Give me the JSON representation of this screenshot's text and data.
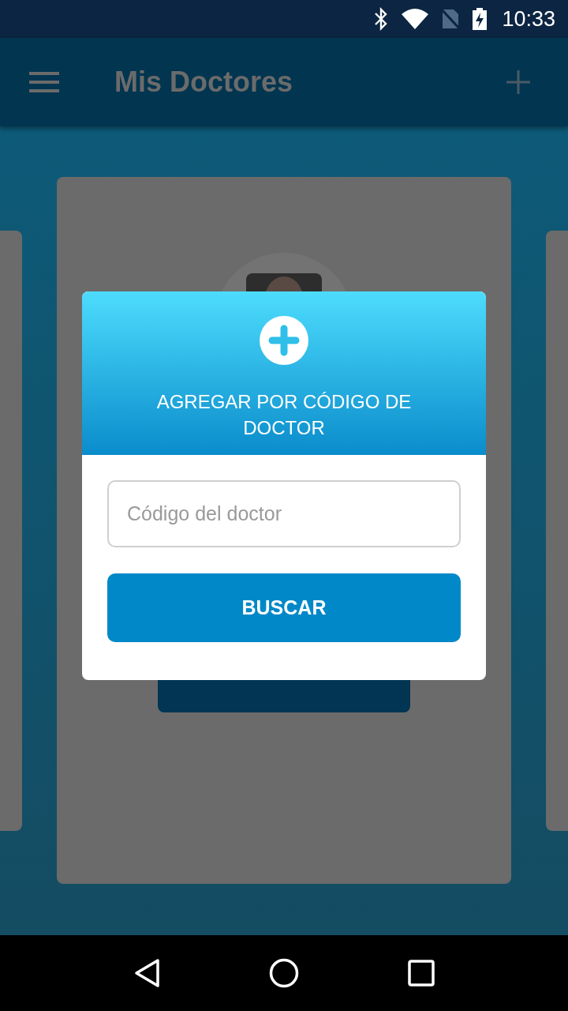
{
  "status_bar": {
    "time": "10:33"
  },
  "app_bar": {
    "title": "Mis Doctores"
  },
  "dialog": {
    "title": "AGREGAR POR CÓDIGO DE DOCTOR",
    "code_field": {
      "placeholder": "Código del doctor"
    },
    "search_button": "BUSCAR"
  }
}
